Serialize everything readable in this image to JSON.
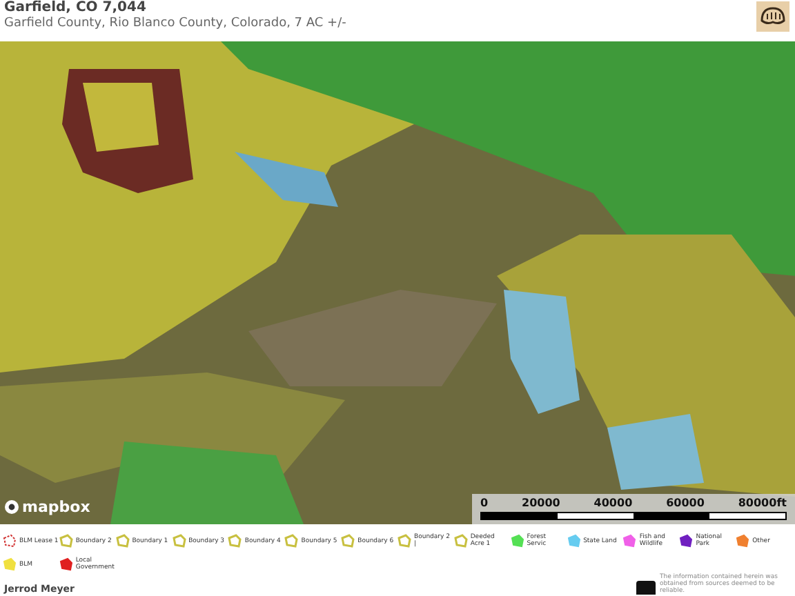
{
  "header": {
    "title": "Garfield, CO 7,044",
    "subtitle": "Garfield County, Rio Blanco County, Colorado, 7 AC +/-"
  },
  "map": {
    "attribution": "mapbox",
    "scale": {
      "ticks": [
        "0",
        "20000",
        "40000",
        "60000",
        "80000ft"
      ]
    }
  },
  "legend": [
    {
      "kind": "dashed",
      "label": "BLM Lease 1",
      "color": "#d03030"
    },
    {
      "kind": "outline",
      "label": "Boundary 2",
      "color": "#c8c040"
    },
    {
      "kind": "outline",
      "label": "Boundary 1",
      "color": "#c8c040"
    },
    {
      "kind": "outline",
      "label": "Boundary 3",
      "color": "#c8c040"
    },
    {
      "kind": "outline",
      "label": "Boundary 4",
      "color": "#c8c040"
    },
    {
      "kind": "outline",
      "label": "Boundary 5",
      "color": "#c8c040"
    },
    {
      "kind": "outline",
      "label": "Boundary 6",
      "color": "#c8c040"
    },
    {
      "kind": "outline",
      "label": "Boundary 2 |",
      "color": "#c8c040"
    },
    {
      "kind": "outline",
      "label": "Deeded Acre 1",
      "color": "#c8c040"
    },
    {
      "kind": "filled",
      "label": "Forest Servic",
      "color": "#55e055"
    },
    {
      "kind": "filled",
      "label": "State Land",
      "color": "#66ccf0"
    },
    {
      "kind": "filled",
      "label": "Fish and Wildlife",
      "color": "#f060e8"
    },
    {
      "kind": "filled",
      "label": "National Park",
      "color": "#7020c0"
    },
    {
      "kind": "filled",
      "label": "Other",
      "color": "#f08030"
    },
    {
      "kind": "filled",
      "label": "BLM",
      "color": "#f0e040"
    },
    {
      "kind": "filled",
      "label": "Local Government",
      "color": "#e02020"
    }
  ],
  "footer": {
    "agent": "Jerrod Meyer",
    "disclaimer": "The information contained herein was obtained from sources deemed to be reliable."
  }
}
